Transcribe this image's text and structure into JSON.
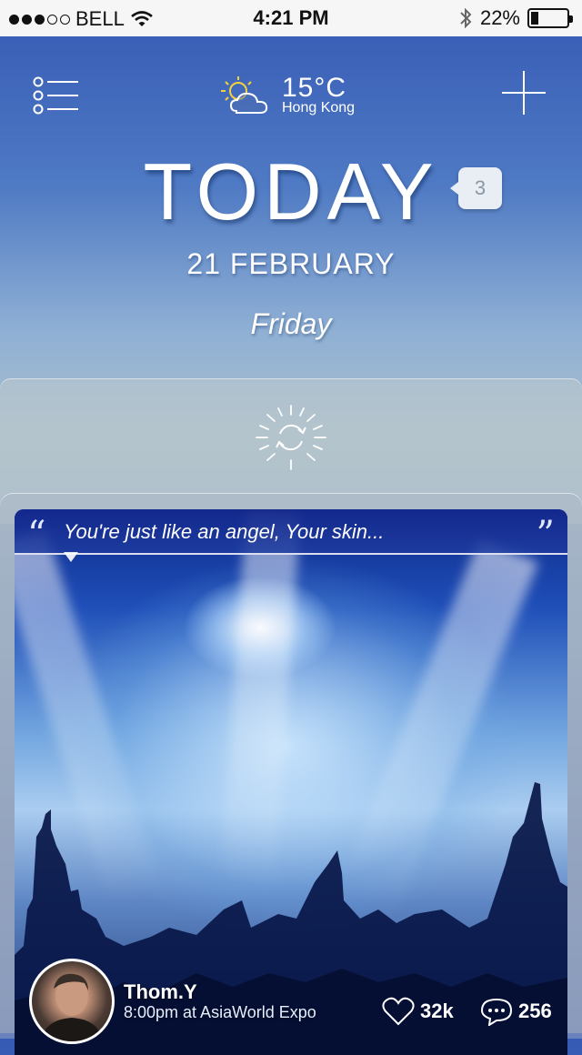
{
  "status_bar": {
    "carrier": "BELL",
    "time": "4:21 PM",
    "battery": "22%",
    "battery_level": 0.22,
    "signal_bars_filled": 3,
    "signal_bars_total": 5,
    "icons": [
      "wifi-icon",
      "bluetooth-icon",
      "battery-icon"
    ]
  },
  "header": {
    "menu_icon": "menu-list-icon",
    "weather_icon": "sun-cloud-icon",
    "temperature": "15°C",
    "city": "Hong Kong",
    "add_icon": "plus-icon"
  },
  "day": {
    "title": "TODAY",
    "notification_count": "3",
    "date": "21 FEBRUARY",
    "weekday": "Friday"
  },
  "refresh": {
    "icon": "refresh-sun-icon"
  },
  "post": {
    "quote": "You're just like an angel, Your skin...",
    "quote_open_mark": "“",
    "quote_close_mark": "”",
    "author": "Thom.Y",
    "meta": "8:00pm at AsiaWorld Expo",
    "likes": "32k",
    "comments": "256"
  },
  "colors": {
    "accent": "#2a4fb0",
    "status_bar_bg": "#f6f6f6"
  }
}
